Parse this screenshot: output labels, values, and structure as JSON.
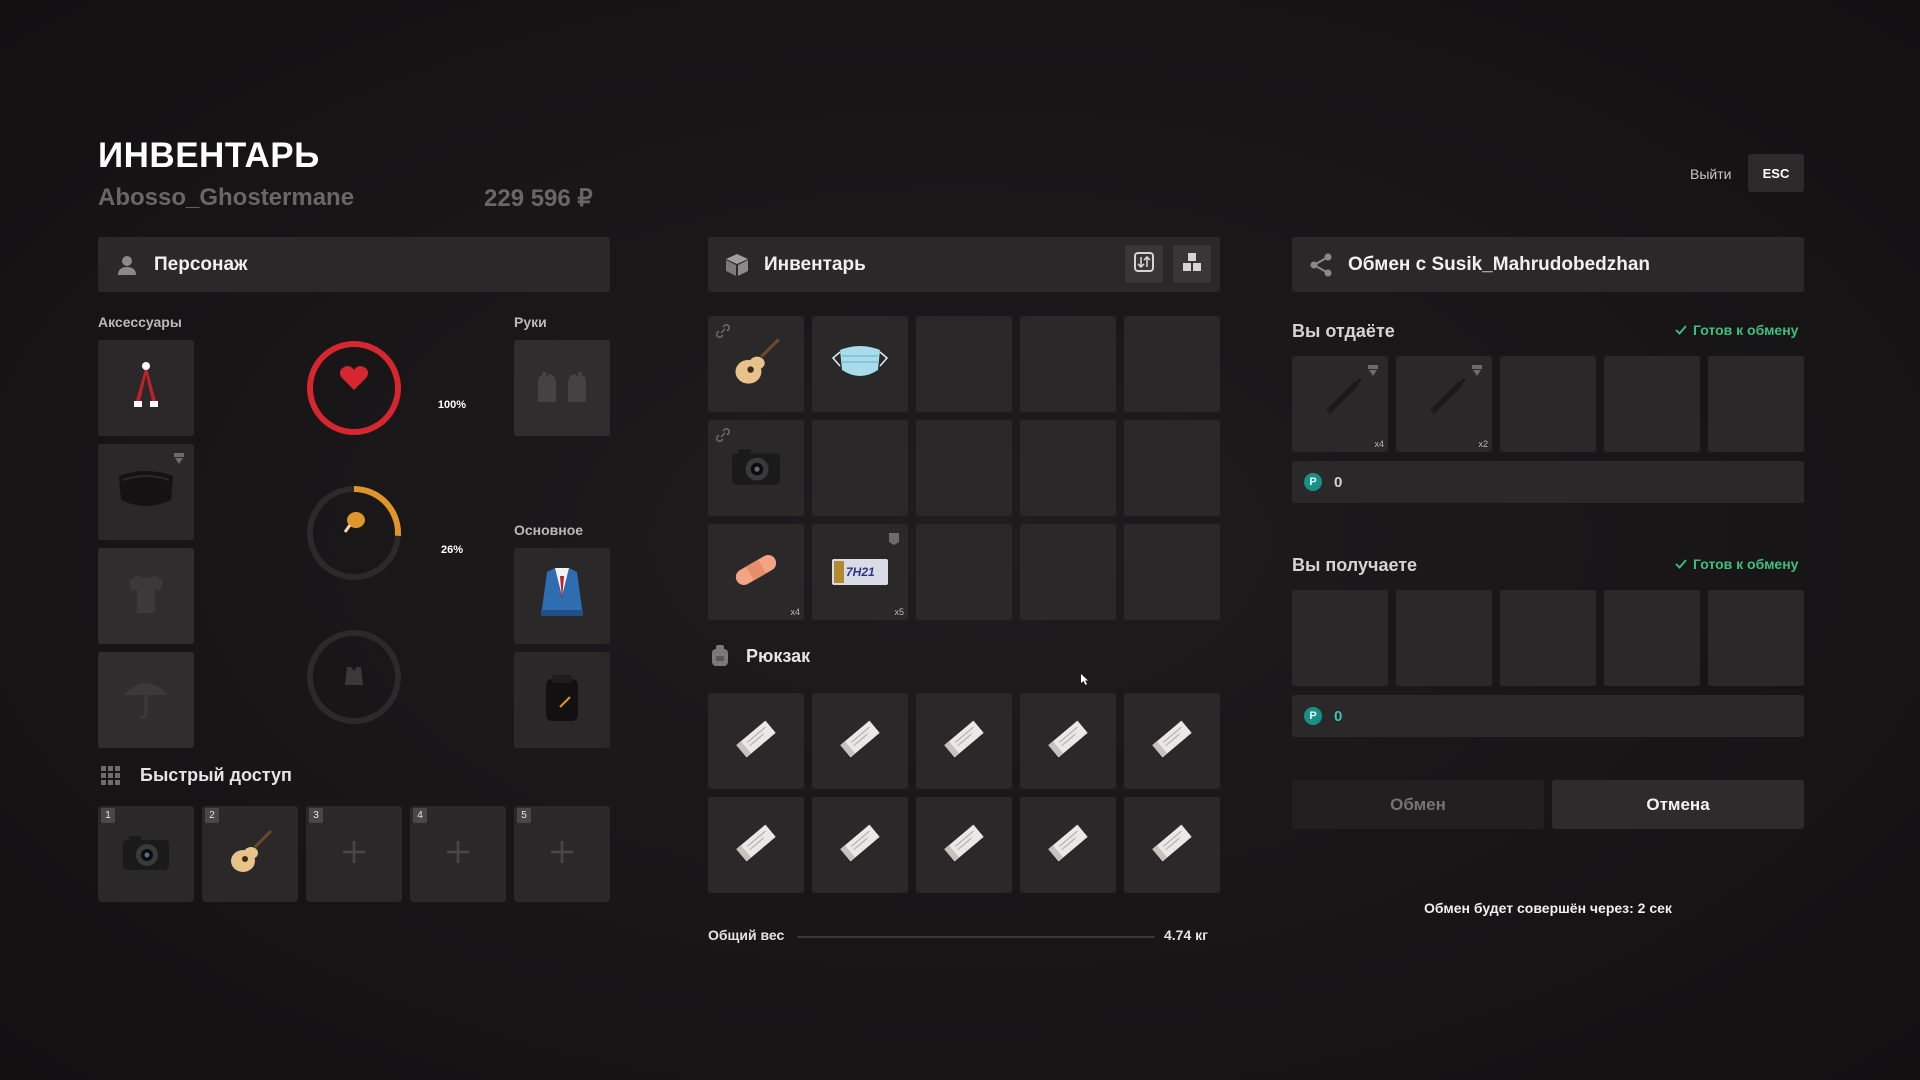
{
  "header": {
    "title": "ИНВЕНТАРЬ",
    "player_name": "Abosso_Ghostermane",
    "money": "229 596 ₽",
    "exit_label": "Выйти",
    "esc_label": "ESC"
  },
  "character": {
    "title": "Персонаж",
    "accessories_label": "Аксессуары",
    "hands_label": "Руки",
    "main_label": "Основное",
    "health_value": "100%",
    "health_fraction": 1.0,
    "hunger_value": "26%",
    "hunger_fraction": 0.26
  },
  "quick_access": {
    "title": "Быстрый доступ",
    "slots": [
      {
        "number": "1",
        "item": "camera"
      },
      {
        "number": "2",
        "item": "guitar"
      },
      {
        "number": "3",
        "item": "empty"
      },
      {
        "number": "4",
        "item": "empty"
      },
      {
        "number": "5",
        "item": "empty"
      }
    ]
  },
  "inventory": {
    "title": "Инвентарь",
    "items": [
      {
        "item": "guitar",
        "qty": ""
      },
      {
        "item": "mask",
        "qty": ""
      },
      {
        "item": "camera",
        "qty": ""
      },
      {
        "item": "bandage",
        "qty": "x4"
      },
      {
        "item": "license-plate",
        "qty": "x5",
        "plate_text": "7H21"
      }
    ],
    "backpack_title": "Рюкзак",
    "weight_label": "Общий вес",
    "weight_value": "4.74 кг"
  },
  "trade": {
    "title": "Обмен с Susik_Mahrudobedzhan",
    "give_title": "Вы отдаёте",
    "give_ready": "Готов к обмену",
    "give_items": [
      {
        "item": "syringe",
        "qty": "x4"
      },
      {
        "item": "syringe",
        "qty": "x2"
      }
    ],
    "give_money": "0",
    "receive_title": "Вы получаете",
    "receive_ready": "Готов к обмену",
    "receive_money": "0",
    "coin_symbol": "Р",
    "exchange_button": "Обмен",
    "cancel_button": "Отмена",
    "timer_text": "Обмен будет совершён через: 2 сек"
  },
  "colors": {
    "accent_green": "#3fbf7f",
    "health_red": "#d6262f",
    "hunger_orange": "#e0952a",
    "coin_teal": "#1a8f86"
  }
}
